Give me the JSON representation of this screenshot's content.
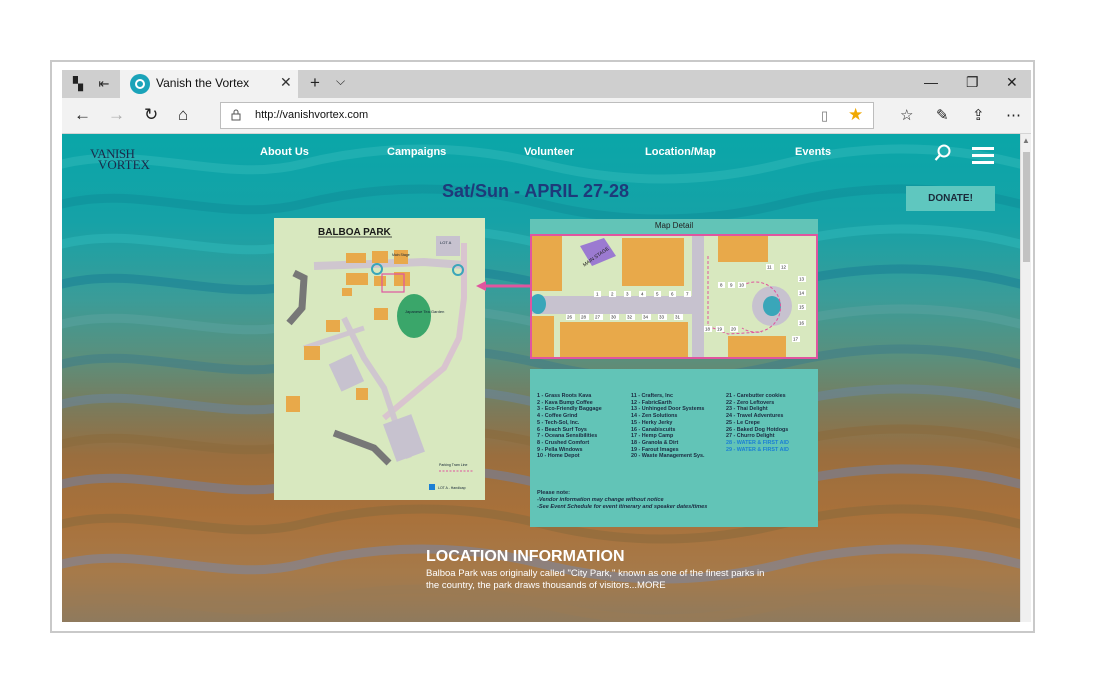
{
  "browser": {
    "tab_title": "Vanish the Vortex",
    "url": "http://vanishvortex.com"
  },
  "site": {
    "logo_line1": "VANISH",
    "logo_line2": "VORTEX",
    "nav": [
      "About Us",
      "Campaigns",
      "Volunteer",
      "Location/Map",
      "Events"
    ],
    "event_dates": "Sat/Sun - APRIL 27-28",
    "donate_label": "DONATE!"
  },
  "park_map": {
    "title": "BALBOA PARK",
    "labels": {
      "lot_a": "LOT A",
      "japanese_garden": "Japanese Tea Garden",
      "main_stage": "Main Stage",
      "legend_parking": "Parking Tram Line",
      "legend_lot": "LOT A - Handicap"
    }
  },
  "map_detail": {
    "title": "Map Detail",
    "main_stage": "MAIN STAGE",
    "top_row": [
      "1",
      "2",
      "3",
      "4",
      "5",
      "6",
      "7"
    ],
    "bottom_row": [
      "26",
      "28",
      "27",
      "30",
      "32",
      "34",
      "33",
      "31"
    ],
    "right_cluster": [
      "11",
      "12",
      "8",
      "9",
      "10",
      "13",
      "14",
      "15",
      "16",
      "17",
      "18",
      "19",
      "20"
    ]
  },
  "vendors": {
    "col1": [
      "1 - Grass Roots Kava",
      "2 - Kava Bump Coffee",
      "3 - Eco-Friendly Baggage",
      "4 - Coffee Grind",
      "5 - Tech-Sol, Inc.",
      "6 - Beach Surf Toys",
      "7 - Oceana Sensibilities",
      "8 - Crushed Comfort",
      "9 - Pella Windows",
      "10 - Home Depot"
    ],
    "col2": [
      "11 - Crafters, Inc",
      "12 - FabricEarth",
      "13 - Unhinged Door Systems",
      "14 - Zen Solutions",
      "15 - Herky Jerky",
      "16 - Canabiscuits",
      "17 - Hemp Camp",
      "18 - Granola & Dirt",
      "19 - Farout Images",
      "20 - Waste Management Sys."
    ],
    "col3": [
      "21 - Carebutter cookies",
      "22 - Zero Leftovers",
      "23 - Thai Delight",
      "24 - Travel Adventures",
      "25 - Le Crepe",
      "26 - Baked Dog Hotdogs",
      "27 - Churro Delight"
    ],
    "col3_aid": [
      "28 - WATER & FIRST AID",
      "29 - WATER & FIRST AID"
    ],
    "notes_title": "Please note:",
    "notes": [
      "-Vendor information may change without notice",
      "-See Event Schedule for event itinerary and speaker dates/times"
    ]
  },
  "location": {
    "heading": "LOCATION INFORMATION",
    "body": "Balboa Park was originally called \"City Park,\" known as one of the finest parks in the country, the park draws thousands of visitors...",
    "more": "MORE"
  },
  "colors": {
    "accent_teal": "#5fc7bf",
    "heading_blue": "#1e3a7a",
    "map_green": "#d8e8bf",
    "stall_orange": "#e8a94a",
    "path_pink": "#e0559f"
  }
}
